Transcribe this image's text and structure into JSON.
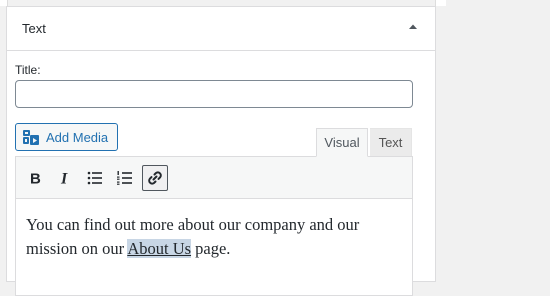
{
  "widget": {
    "title": "Text",
    "toggle_icon": "triangle-up-icon"
  },
  "form": {
    "title_label": "Title:",
    "title_value": "",
    "add_media_label": "Add Media",
    "add_media_icon": "media-icon"
  },
  "editor": {
    "tabs": [
      "Visual",
      "Text"
    ],
    "active_tab": "Visual",
    "toolbar": [
      {
        "name": "bold-icon",
        "label": "B"
      },
      {
        "name": "italic-icon",
        "label": "I"
      },
      {
        "name": "bullet-list-icon"
      },
      {
        "name": "numbered-list-icon"
      },
      {
        "name": "link-icon",
        "active": true
      }
    ],
    "content": {
      "text_before": "You can find out more about our company and our mission on our ",
      "link_text": "About Us",
      "text_after": " page."
    }
  },
  "colors": {
    "accent": "#2271b1",
    "selection": "#c8d6e5"
  }
}
